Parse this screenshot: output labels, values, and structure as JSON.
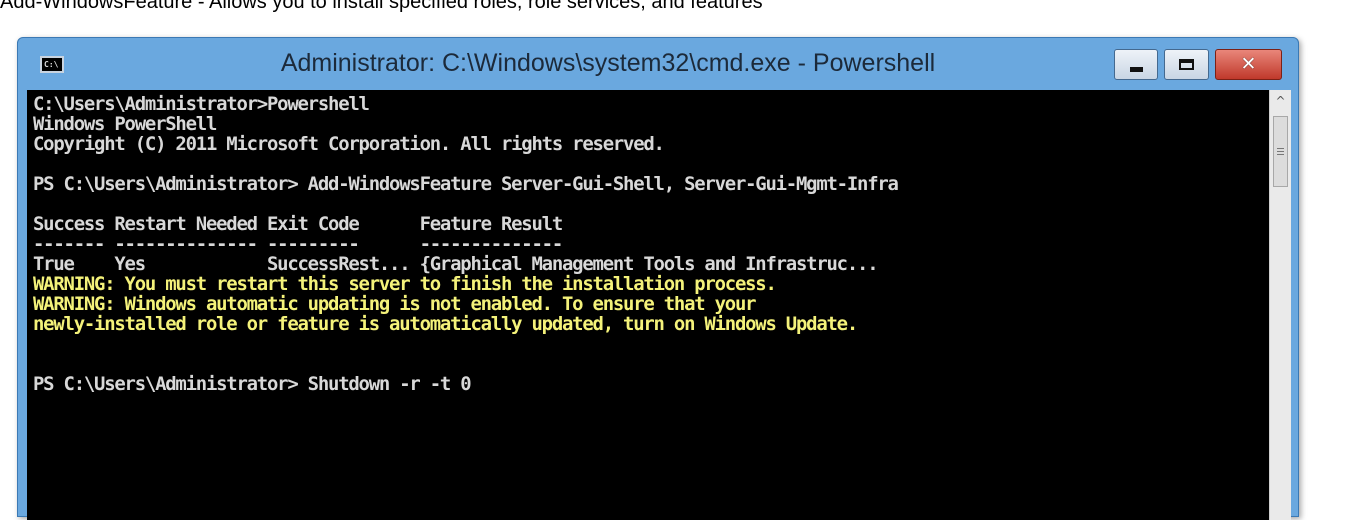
{
  "caption": "Add-WindowsFeature - Allows you to install specified roles, role services, and features",
  "window": {
    "title": "Administrator: C:\\Windows\\system32\\cmd.exe - Powershell",
    "icon_text": "C:\\",
    "icon": "console-icon"
  },
  "controls": {
    "minimize_icon": "minimize-icon",
    "maximize_icon": "maximize-icon",
    "close_icon": "close-icon",
    "close_glyph": "✕"
  },
  "scrollbar": {
    "up_arrow": "^"
  },
  "console": {
    "colors": {
      "background": "#000000",
      "text": "#d8d8d8",
      "warning": "#f4f27a"
    },
    "lines": [
      {
        "text": "C:\\Users\\Administrator>Powershell",
        "type": "normal"
      },
      {
        "text": "Windows PowerShell",
        "type": "normal"
      },
      {
        "text": "Copyright (C) 2011 Microsoft Corporation. All rights reserved.",
        "type": "normal"
      },
      {
        "text": "",
        "type": "normal"
      },
      {
        "text": "PS C:\\Users\\Administrator> Add-WindowsFeature Server-Gui-Shell, Server-Gui-Mgmt-Infra",
        "type": "normal"
      },
      {
        "text": "",
        "type": "normal"
      },
      {
        "text": "Success Restart Needed Exit Code      Feature Result",
        "type": "normal"
      },
      {
        "text": "------- -------------- ---------      --------------",
        "type": "normal"
      },
      {
        "text": "True    Yes            SuccessRest... {Graphical Management Tools and Infrastruc...",
        "type": "normal"
      },
      {
        "text": "WARNING: You must restart this server to finish the installation process.",
        "type": "warning"
      },
      {
        "text": "WARNING: Windows automatic updating is not enabled. To ensure that your",
        "type": "warning"
      },
      {
        "text": "newly-installed role or feature is automatically updated, turn on Windows Update.",
        "type": "warning"
      },
      {
        "text": "",
        "type": "normal"
      },
      {
        "text": "",
        "type": "normal"
      },
      {
        "text": "PS C:\\Users\\Administrator> Shutdown -r -t 0",
        "type": "normal"
      }
    ]
  }
}
